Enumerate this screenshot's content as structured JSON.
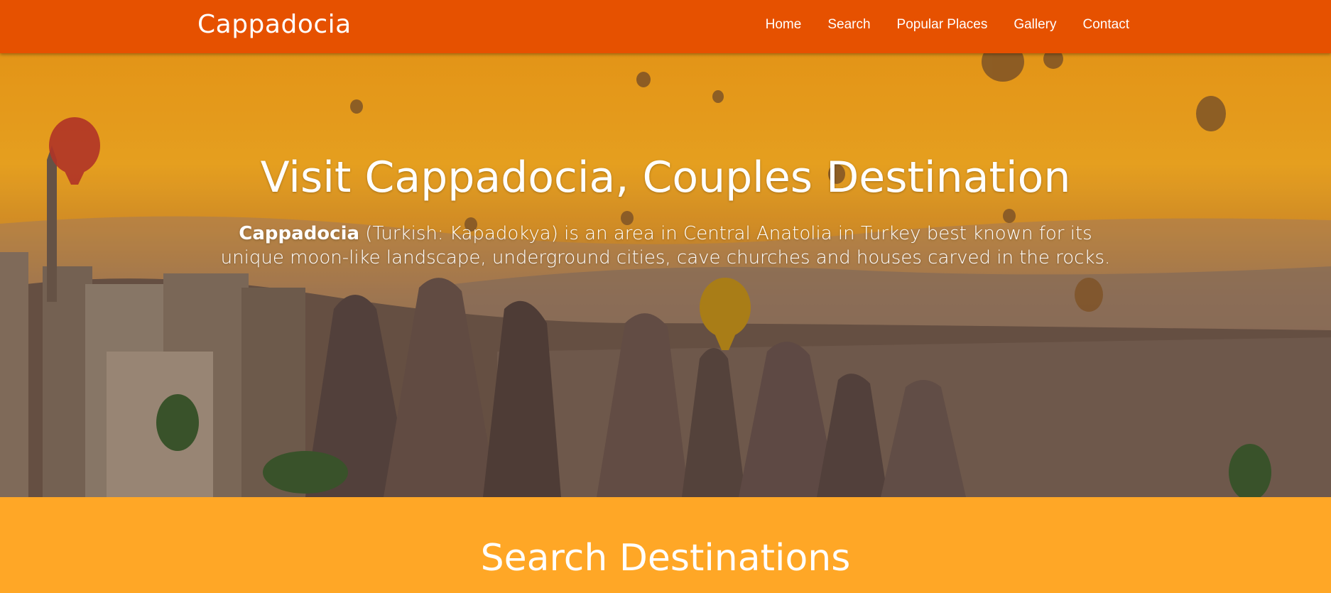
{
  "navbar": {
    "brand": "Cappadocia",
    "links": [
      "Home",
      "Search",
      "Popular Places",
      "Gallery",
      "Contact"
    ]
  },
  "hero": {
    "title": "Visit Cappadocia, Couples Destination",
    "text_bold": "Cappadocia",
    "text_rest": " (Turkish: Kapadokya) is an area in Central Anatolia in Turkey best known for its unique moon-like landscape, underground cities, cave churches and houses carved in the rocks.",
    "image": "hot-air-balloons-over-fairy-chimneys"
  },
  "search": {
    "title": "Search Destinations"
  },
  "colors": {
    "navbar": "#e65100",
    "section": "#ffa726",
    "text": "#ffffff"
  }
}
